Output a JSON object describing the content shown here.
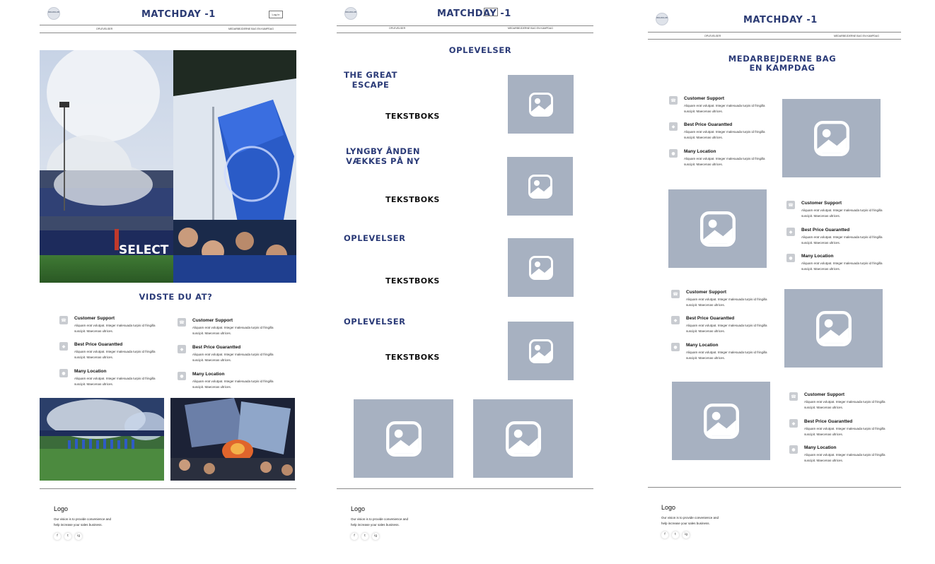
{
  "brand": {
    "name": "MATCHDAY -1",
    "badge_text": "BOLDKLUB"
  },
  "header": {
    "nav": [
      "OPLEVELSER",
      "MEDARBEJDERNE BAG EN KAMPDAG"
    ],
    "login_label": "Log in"
  },
  "page1": {
    "section_title": "VIDSTE DU AT?",
    "features": [
      {
        "icon": "phone-icon",
        "title": "Customer Support",
        "text": "Aliquam erat volutpat. Integer malesuada turpis id fringilla suscipit. Maecenas ultrices."
      },
      {
        "icon": "tag-icon",
        "title": "Best Price Guarantted",
        "text": "Aliquam erat volutpat. Integer malesuada turpis id fringilla suscipit. Maecenas ultrices."
      },
      {
        "icon": "location-icon",
        "title": "Many Location",
        "text": "Aliquam erat volutpat. Integer malesuada turpis id fringilla suscipit. Maecenas ultrices."
      }
    ]
  },
  "page2": {
    "section_title": "OPLEVELSER",
    "items": [
      {
        "heading": "THE GREAT ESCAPE",
        "body": "TEKSTBOKS"
      },
      {
        "heading": "LYNGBY ÅNDEN VÆKKES PÅ NY",
        "body": "TEKSTBOKS"
      },
      {
        "heading": "OPLEVELSER",
        "body": "TEKSTBOKS"
      },
      {
        "heading": "OPLEVELSER",
        "body": "TEKSTBOKS"
      }
    ]
  },
  "page3": {
    "section_title": "MEDARBEJDERNE BAG EN KAMPDAG"
  },
  "footer": {
    "logo": "Logo",
    "text": "Our vision is to provide convenience and help increase your sales business.",
    "socials": [
      "f",
      "t",
      "ig"
    ]
  },
  "colors": {
    "brand_blue": "#2b3b78",
    "placeholder": "#a7b1c1",
    "icon_bg": "#c9ccd1"
  }
}
